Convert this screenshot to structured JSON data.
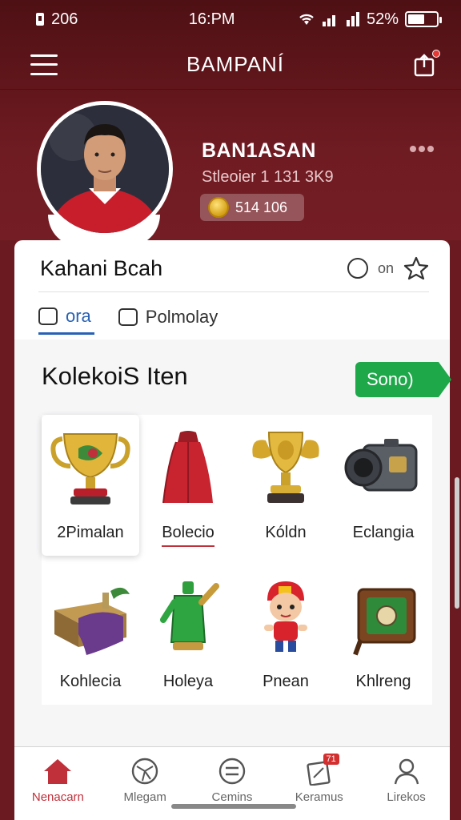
{
  "status_bar": {
    "left_text": "206",
    "time": "16:PM",
    "battery": "52%"
  },
  "app_bar": {
    "title": "BAMPANÍ"
  },
  "profile": {
    "name": "BAN1ASAN",
    "subtitle": "Stleoier 1 131 3K9",
    "coins": "514 106"
  },
  "card": {
    "title": "Kahani Bcah",
    "action_text": "on",
    "tabs": [
      {
        "label": "ora",
        "active": true
      },
      {
        "label": "Polmolay",
        "active": false
      }
    ]
  },
  "section": {
    "title": "KolekoiS Iten",
    "see_all": "Sono)",
    "items": [
      {
        "label": "2Pimalan",
        "icon": "gold-trophy-icon"
      },
      {
        "label": "Bolecio",
        "icon": "red-cloak-icon"
      },
      {
        "label": "Kóldn",
        "icon": "winged-trophy-icon"
      },
      {
        "label": "Eclangia",
        "icon": "camera-icon"
      },
      {
        "label": "Kohlecia",
        "icon": "treasure-chest-icon"
      },
      {
        "label": "Holeya",
        "icon": "green-figure-icon"
      },
      {
        "label": "Pnean",
        "icon": "kid-character-icon"
      },
      {
        "label": "Khlreng",
        "icon": "green-box-icon"
      }
    ]
  },
  "bottom_nav": [
    {
      "label": "Nenacarn",
      "icon": "home-icon",
      "active": true
    },
    {
      "label": "Mlegam",
      "icon": "ball-icon",
      "active": false
    },
    {
      "label": "Cemins",
      "icon": "menu-circle-icon",
      "active": false
    },
    {
      "label": "Keramus",
      "icon": "notification-icon",
      "badge": "71",
      "active": false
    },
    {
      "label": "Lirekos",
      "icon": "profile-icon",
      "active": false
    }
  ],
  "colors": {
    "brand": "#6f1b22",
    "accent_green": "#1fa84a",
    "active_blue": "#2862b5",
    "active_red": "#c0303a"
  }
}
